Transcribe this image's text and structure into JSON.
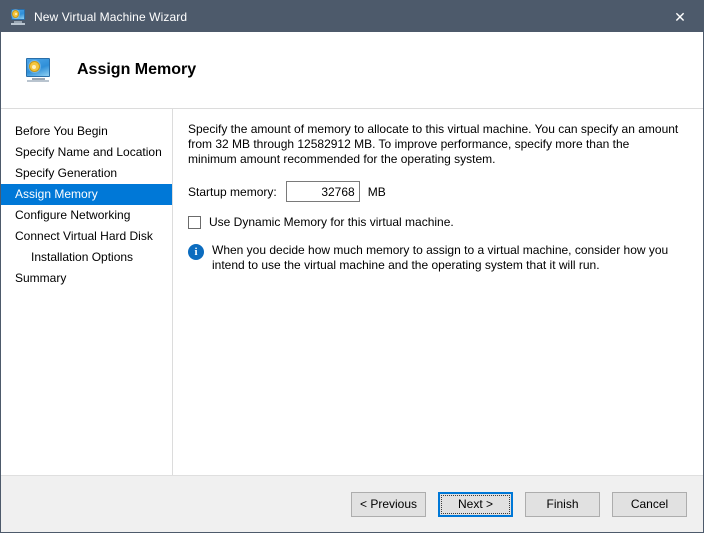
{
  "titlebar": {
    "title": "New Virtual Machine Wizard",
    "icon": "virtual-machine-icon",
    "close_label": "✕"
  },
  "header": {
    "title": "Assign Memory",
    "icon": "virtual-machine-icon"
  },
  "sidebar": {
    "items": [
      {
        "label": "Before You Begin",
        "selected": false,
        "sub": false
      },
      {
        "label": "Specify Name and Location",
        "selected": false,
        "sub": false
      },
      {
        "label": "Specify Generation",
        "selected": false,
        "sub": false
      },
      {
        "label": "Assign Memory",
        "selected": true,
        "sub": false
      },
      {
        "label": "Configure Networking",
        "selected": false,
        "sub": false
      },
      {
        "label": "Connect Virtual Hard Disk",
        "selected": false,
        "sub": false
      },
      {
        "label": "Installation Options",
        "selected": false,
        "sub": true
      },
      {
        "label": "Summary",
        "selected": false,
        "sub": false
      }
    ]
  },
  "content": {
    "intro": "Specify the amount of memory to allocate to this virtual machine. You can specify an amount from 32 MB through 12582912 MB. To improve performance, specify more than the minimum amount recommended for the operating system.",
    "startup_memory_label": "Startup memory:",
    "startup_memory_value": "32768",
    "startup_memory_unit": "MB",
    "dynamic_memory_label": "Use Dynamic Memory for this virtual machine.",
    "dynamic_memory_checked": false,
    "note_icon_glyph": "i",
    "note_text": "When you decide how much memory to assign to a virtual machine, consider how you intend to use the virtual machine and the operating system that it will run."
  },
  "footer": {
    "previous_label": "< Previous",
    "next_label": "Next >",
    "finish_label": "Finish",
    "cancel_label": "Cancel"
  },
  "colors": {
    "titlebar_bg": "#4d5a6b",
    "accent_blue": "#0078d7",
    "info_blue": "#0b6cbf",
    "footer_bg": "#f0f0f0"
  }
}
